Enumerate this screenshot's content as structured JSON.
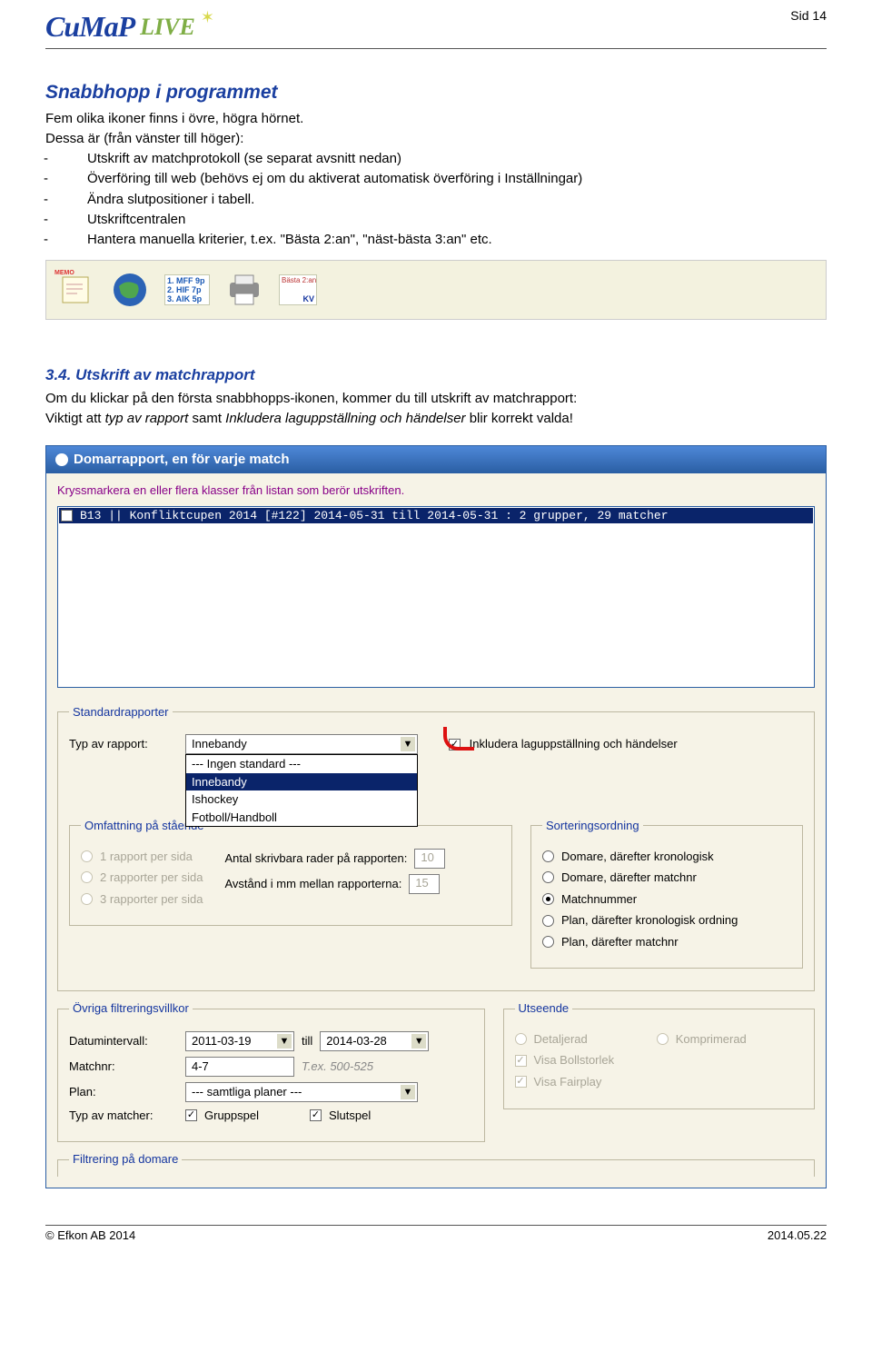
{
  "header": {
    "logo_main": "CuMaP",
    "logo_secondary": "LIVE",
    "page_number": "Sid 14"
  },
  "section1_title": "Snabbhopp i programmet",
  "section1_intro": "Fem olika ikoner finns i övre, högra hörnet.",
  "section1_lead": "Dessa är (från vänster till höger):",
  "section1_bullets": [
    "Utskrift av matchprotokoll (se separat avsnitt nedan)",
    "Överföring till web (behövs ej om du aktiverat automatisk överföring i Inställningar)",
    "Ändra slutpositioner i tabell.",
    "Utskriftcentralen",
    "Hantera manuella kriterier, t.ex. \"Bästa 2:an\", \"näst-bästa 3:an\" etc."
  ],
  "toolbar": {
    "memo_tag": "MEMO",
    "mini_list": [
      "1. MFF 9p",
      "2. HIF 7p",
      "3. AIK 5p"
    ],
    "kv_top": "Bästa 2:an",
    "kv_bottom": "KV"
  },
  "section2_title": "3.4. Utskrift av matchrapport",
  "section2_p1a": "Om du klickar på den första snabbhopps-ikonen, kommer du till utskrift av matchrapport:",
  "section2_p1b_pre": "Viktigt att ",
  "section2_p1b_em1": "typ av rapport",
  "section2_p1b_mid": " samt ",
  "section2_p1b_em2": "Inkludera laguppställning och händelser",
  "section2_p1b_post": " blir korrekt valda!",
  "dialog": {
    "title": "Domarrapport, en för varje match",
    "hint": "Kryssmarkera en eller flera klasser från listan som berör utskriften.",
    "listrow": "B13 || Konfliktcupen 2014 [#122] 2014-05-31 till 2014-05-31 : 2 grupper, 29 matcher",
    "fs_standard": "Standardrapporter",
    "lbl_typ": "Typ av rapport:",
    "ddl_typ_value": "Innebandy",
    "ddl_typ_options": [
      "--- Ingen standard ---",
      "Innebandy",
      "Ishockey",
      "Fotboll/Handboll"
    ],
    "cb_inkl": "Inkludera laguppställning och händelser",
    "fs_omf": "Omfattning på stående",
    "omf_opts": [
      "1 rapport per sida",
      "2 rapporter per sida",
      "3 rapporter per sida"
    ],
    "lbl_rader": "Antal skrivbara rader på rapporten:",
    "val_rader": "10",
    "lbl_avst": "Avstånd i mm mellan rapporterna:",
    "val_avst": "15",
    "fs_sort": "Sorteringsordning",
    "sort_opts": [
      "Domare, därefter kronologisk",
      "Domare, därefter matchnr",
      "Matchnummer",
      "Plan, därefter kronologisk ordning",
      "Plan, därefter matchnr"
    ],
    "fs_ovr": "Övriga filtreringsvillkor",
    "lbl_datum": "Datumintervall:",
    "val_d1": "2011-03-19",
    "lbl_till": "till",
    "val_d2": "2014-03-28",
    "lbl_matchnr": "Matchnr:",
    "val_matchnr": "4-7",
    "hint_matchnr": "T.ex. 500-525",
    "lbl_plan": "Plan:",
    "val_plan": "--- samtliga planer ---",
    "lbl_typm": "Typ av matcher:",
    "cb_grupp": "Gruppspel",
    "cb_slut": "Slutspel",
    "fs_uts": "Utseende",
    "r_det": "Detaljerad",
    "r_komp": "Komprimerad",
    "cb_boll": "Visa Bollstorlek",
    "cb_fair": "Visa Fairplay",
    "fs_dom": "Filtrering på domare"
  },
  "footer": {
    "left": "© Efkon AB 2014",
    "right": "2014.05.22"
  }
}
